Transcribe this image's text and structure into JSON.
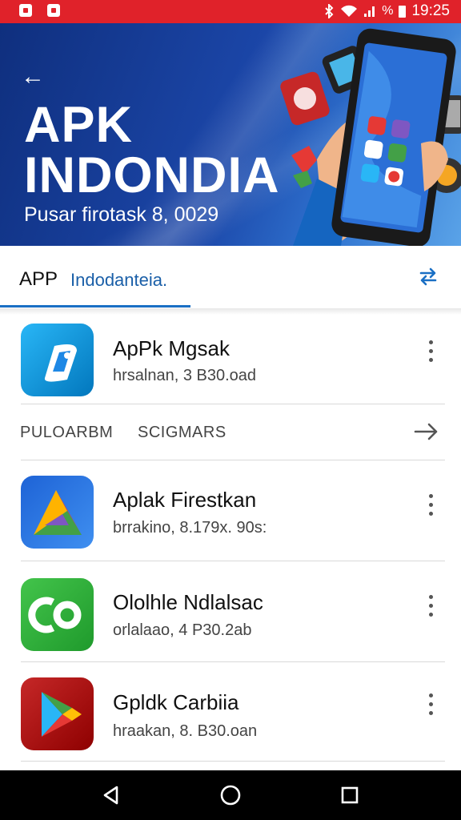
{
  "status_bar": {
    "time": "19:25",
    "signal_text": "%",
    "icons": [
      "notification-icon",
      "message-icon",
      "bluetooth-icon",
      "wifi-icon",
      "signal-icon",
      "battery-icon"
    ],
    "background": "#e0222a"
  },
  "banner": {
    "title_line1": "APK",
    "title_line2": "INDONDIA",
    "subtitle": "Pusar firotask 8, 0029",
    "back_icon": "arrow-left-icon",
    "colors": {
      "dark": "#0f2f7e",
      "light": "#5aa3e8"
    }
  },
  "tabs": {
    "primary": "APP",
    "secondary": "Indodanteia.",
    "swap_icon": "swap-arrows-icon",
    "accent": "#1a6fc4"
  },
  "section": {
    "left_label": "PULOARBM",
    "right_label": "SCIGMARS",
    "arrow_icon": "arrow-right-icon"
  },
  "apps": [
    {
      "name": "ApPk Mgsak",
      "meta": "hrsalnan, 3 B30.oad",
      "icon": "apk-app-icon"
    },
    {
      "name": "Aplak Firestkan",
      "meta": "brrakino, 8.179x. 90s:",
      "icon": "colorful-a-app-icon"
    },
    {
      "name": "Ololhle Ndlalsac",
      "meta": "orlalaao, 4 P30.2ab",
      "icon": "green-co-app-icon"
    },
    {
      "name": "Gpldk Carbiia",
      "meta": "hraakan, 8. B30.oan",
      "icon": "play-store-icon"
    }
  ],
  "nav_bar": {
    "icons": [
      "back-triangle-icon",
      "home-circle-icon",
      "recents-square-icon"
    ]
  }
}
